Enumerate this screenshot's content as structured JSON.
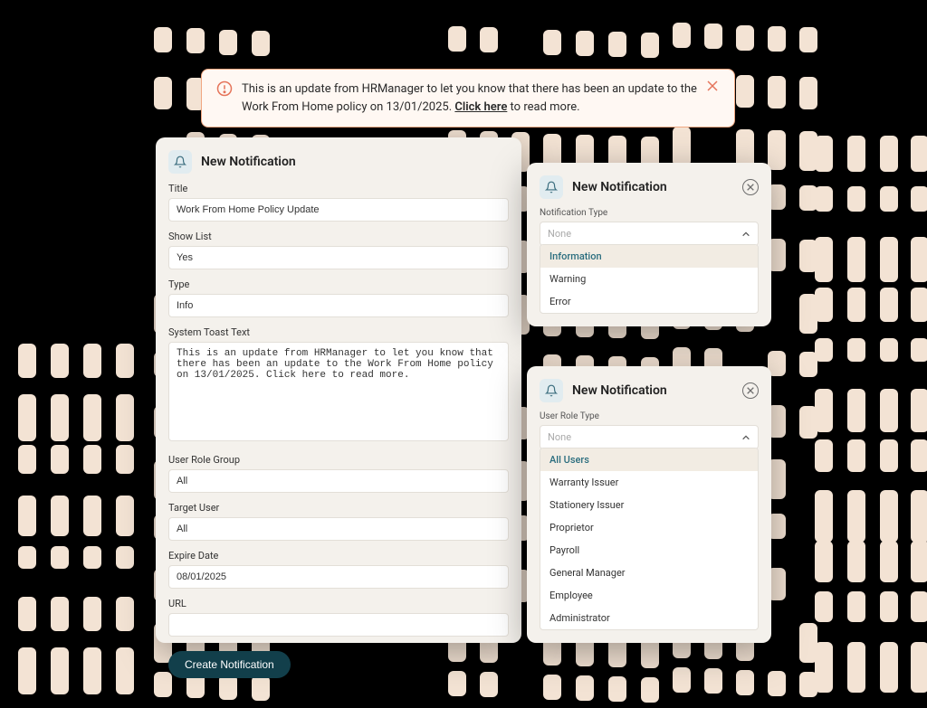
{
  "toast": {
    "text_before": "This is an update from HRManager to let you know that there has been an update to the Work From Home policy on 13/01/2025. ",
    "link_text": "Click here",
    "text_after": " to read more."
  },
  "main": {
    "header": "New Notification",
    "labels": {
      "title": "Title",
      "show_list": "Show List",
      "type": "Type",
      "toast_text": "System Toast Text",
      "user_role_group": "User Role Group",
      "target_user": "Target User",
      "expire_date": "Expire Date",
      "url": "URL"
    },
    "values": {
      "title": "Work From Home Policy Update",
      "show_list": "Yes",
      "type": "Info",
      "toast_text": "This is an update from HRManager to let you know that there has been an update to the Work From Home policy on 13/01/2025. Click here to read more.",
      "user_role_group": "All",
      "target_user": "All",
      "expire_date": "08/01/2025",
      "url": ""
    },
    "button": "Create Notification"
  },
  "popup_type": {
    "header": "New Notification",
    "label": "Notification Type",
    "placeholder": "None",
    "options": [
      "Information",
      "Warning",
      "Error"
    ],
    "selected": "Information"
  },
  "popup_role": {
    "header": "New Notification",
    "label": "User Role Type",
    "placeholder": "None",
    "options": [
      "All Users",
      "Warranty Issuer",
      "Stationery Issuer",
      "Proprietor",
      "Payroll",
      "General Manager",
      "Employee",
      "Administrator"
    ],
    "selected": "All Users"
  }
}
